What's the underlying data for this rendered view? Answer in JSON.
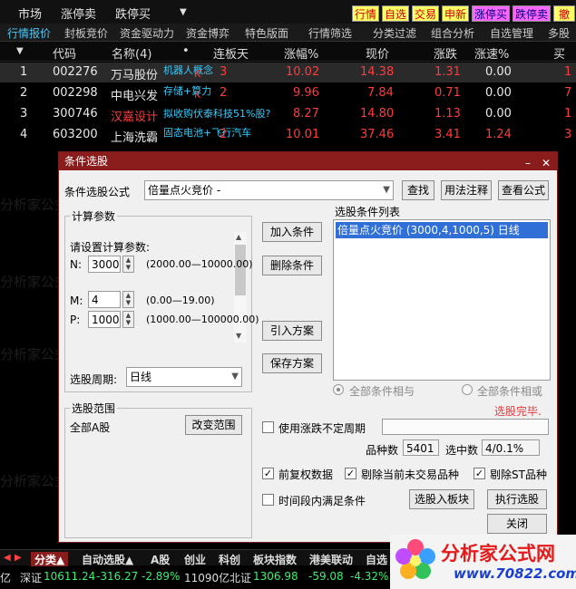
{
  "menubar": {
    "items": [
      "市场",
      "涨停卖",
      "跌停买"
    ],
    "quick_buttons": [
      {
        "label": "行情",
        "bg": "#ffff66",
        "fg": "#cc0000"
      },
      {
        "label": "自选",
        "bg": "#ffff66",
        "fg": "#cc0000"
      },
      {
        "label": "交易",
        "bg": "#ffff66",
        "fg": "#cc0000"
      },
      {
        "label": "申新",
        "bg": "#ffff66",
        "fg": "#cc0000"
      },
      {
        "label": "涨停买",
        "bg": "#ff66ff",
        "fg": "#000080"
      },
      {
        "label": "跌停卖",
        "bg": "#ff66ff",
        "fg": "#000080"
      },
      {
        "label": "撤单",
        "bg": "#ffff66",
        "fg": "#cc0000"
      }
    ]
  },
  "tabs": [
    "行情报价",
    "封板竞价",
    "资金驱动力",
    "资金博弈",
    "特色版面",
    "行情筛选",
    "分类过滤",
    "组合分析",
    "自选管理",
    "多股"
  ],
  "grid": {
    "headers": [
      "代码",
      "名称(4)",
      "•",
      "连板天",
      "涨幅%",
      "现价",
      "涨跌",
      "涨速%",
      "买"
    ],
    "rows": [
      {
        "idx": "1",
        "code": "002276",
        "name": "万马股份",
        "tag": "机器人概念",
        "mark": "K",
        "days": "3",
        "pct": "10.02",
        "price": "14.38",
        "chg": "1.31",
        "speed": "0.00",
        "buy": "1"
      },
      {
        "idx": "2",
        "code": "002298",
        "name": "中电兴发",
        "tag": "存储+算力",
        "mark": "K",
        "days": "2",
        "pct": "9.96",
        "price": "7.84",
        "chg": "0.71",
        "speed": "0.00",
        "buy": "7"
      },
      {
        "idx": "3",
        "code": "300746",
        "name": "汉嘉设计",
        "tag": "拟收购伏泰科技51%股?",
        "mark": "",
        "days": "",
        "pct": "8.27",
        "price": "14.80",
        "chg": "1.13",
        "speed": "0.00",
        "buy": "1"
      },
      {
        "idx": "4",
        "code": "603200",
        "name": "上海洗霸",
        "tag": "固态电池+飞行汽车",
        "mark": "",
        "days": "2",
        "pct": "10.01",
        "price": "37.46",
        "chg": "3.41",
        "speed": "1.24",
        "buy": "3"
      }
    ]
  },
  "dialog": {
    "title": "条件选股",
    "formula_label": "条件选股公式",
    "formula_value": "倍量点火竞价 -",
    "btn_find": "查找",
    "btn_usage": "用法注释",
    "btn_view": "查看公式",
    "params_group": "计算参数",
    "params_prompt": "请设置计算参数:",
    "params": [
      {
        "name": "N:",
        "value": "3000",
        "range": "(2000.00—10000.00)"
      },
      {
        "name": "M:",
        "value": "4",
        "range": "(0.00—19.00)"
      },
      {
        "name": "P:",
        "value": "1000",
        "range": "(1000.00—100000.00)"
      }
    ],
    "period_label": "选股周期:",
    "period_value": "日线",
    "btn_add": "加入条件",
    "btn_delete": "删除条件",
    "btn_import": "引入方案",
    "btn_save": "保存方案",
    "list_label": "选股条件列表",
    "list_items": [
      "倍量点火竞价 (3000,4,1000,5) 日线"
    ],
    "radio_and": "全部条件相与",
    "radio_or": "全部条件相或",
    "status_done": "选股完毕.",
    "scope_group": "选股范围",
    "scope_value": "全部A股",
    "btn_change_scope": "改变范围",
    "use_uncertain_period": "使用涨跌不定周期",
    "count_label": "品种数",
    "count_value": "5401",
    "selected_label": "选中数",
    "selected_value": "4/0.1%",
    "chk_qfq": "前复权数据",
    "chk_exclude_untraded": "剔除当前未交易品种",
    "chk_exclude_st": "剔除ST品种",
    "chk_time_range": "时间段内满足条件",
    "btn_to_block": "选股入板块",
    "btn_run": "执行选股",
    "btn_close": "关闭"
  },
  "bottom_tabs": [
    "分类▲",
    "自动选股▲",
    "A股",
    "创业",
    "科创",
    "板块指数",
    "港美联动",
    "自选"
  ],
  "status": {
    "prefix": "亿",
    "index_name": "深证",
    "index_value": "10611.24",
    "index_chg": "-316.27",
    "index_pct": "-2.89%",
    "volume": "11090亿",
    "index2_name": "北证",
    "index2_value": "1306.98",
    "index2_chg": "-59.08",
    "index2_pct": "-4.32%"
  },
  "logo": {
    "text": "分析家公式网",
    "url": "www.70822.com"
  },
  "watermark": "分析家公式网www.70822.com",
  "colors": {
    "up": "#ff3b3b",
    "cyan": "#33ccff",
    "dialog_title": "#8a1c1c",
    "list_selected": "#2f6fd6"
  }
}
